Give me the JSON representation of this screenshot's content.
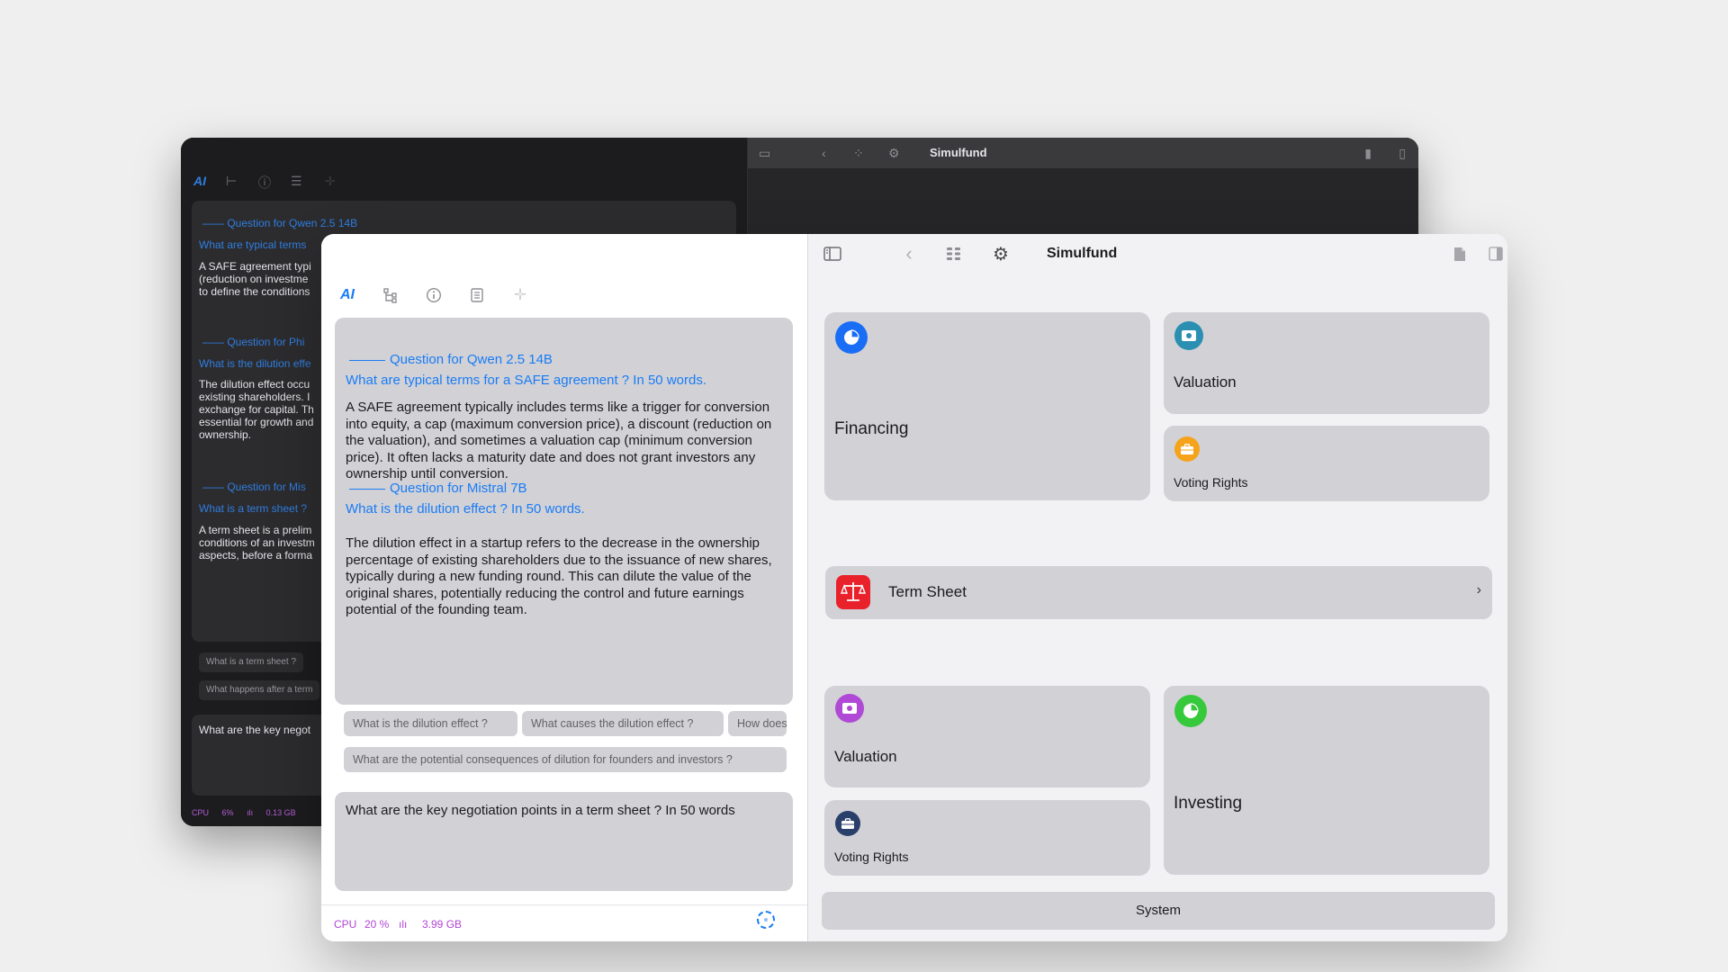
{
  "app_title": "Simulfund",
  "left_tabs": [
    {
      "name": "ai-tab",
      "glyph": "AI"
    },
    {
      "name": "tree-icon",
      "glyph": "⊢"
    },
    {
      "name": "info-icon",
      "glyph": "ⓘ"
    },
    {
      "name": "document-icon",
      "glyph": "☰"
    },
    {
      "name": "add-icon",
      "glyph": "✛"
    }
  ],
  "chat": [
    {
      "header": "Question for Qwen 2.5 14B",
      "question": "What are typical terms for a SAFE agreement ?  In 50 words.",
      "answer": "A SAFE agreement typically includes terms like a trigger for conversion into equity, a cap (maximum conversion price), a discount (reduction on the valuation), and sometimes a valuation cap (minimum conversion price). It often lacks a maturity date and does not grant investors any ownership until conversion."
    },
    {
      "header": "Question for Mistral 7B",
      "question": "What is the dilution effect  ?  In 50 words.",
      "answer": "The dilution effect in a startup refers to the decrease in the ownership percentage of existing shareholders due to the issuance of new shares, typically during a new funding round. This can dilute the value of the original shares, potentially reducing the control and future earnings potential of the founding team."
    }
  ],
  "suggestions": [
    "What is the dilution effect  ?",
    "What causes the dilution effect  ?",
    "How does",
    "What are the potential consequences of dilution for founders and investors  ?"
  ],
  "input_text": "What are the key negotiation points in a term sheet  ?  In 50 words",
  "status": {
    "cpu_label": "CPU",
    "cpu_value": "20 %",
    "mem_glyph": "ılı",
    "mem_value": "3.99 GB"
  },
  "cards": {
    "financing": "Financing",
    "valuation_top": "Valuation",
    "voting_top": "Voting Rights",
    "term_sheet": "Term Sheet",
    "valuation_bottom": "Valuation",
    "voting_bottom": "Voting Rights",
    "investing": "Investing",
    "system": "System"
  },
  "colors": {
    "accent": "#1a7cf5",
    "financing_icon": "#1a6ef5",
    "valuation_top_icon": "#2a8fb0",
    "voting_top_icon": "#f5a31a",
    "term_sheet_icon": "#e8212b",
    "valuation_bottom_icon": "#b04ad6",
    "voting_bottom_icon": "#2b3f6b",
    "investing_icon": "#36c93b",
    "status_text": "#b245d6"
  },
  "back_window": {
    "title": "Simulfund",
    "chat": [
      {
        "header": "Question for Qwen 2.5 14B",
        "question": "What are typical terms",
        "answer": "A SAFE agreement typi\n(reduction on investme\nto define the conditions"
      },
      {
        "header": "Question for Phi",
        "question": "What is the dilution effe",
        "answer": "The dilution effect occu\nexisting shareholders. I\nexchange for capital. Th\nessential for growth and\nownership."
      },
      {
        "header": "Question for Mis",
        "question": "What is a term sheet  ?",
        "answer": "A term sheet is a prelim\nconditions of an investm\naspects, before a forma"
      }
    ],
    "chips": [
      "What is a term sheet  ?",
      "What happens after a term"
    ],
    "input_text": "What are the key negot",
    "status": {
      "cpu_label": "CPU",
      "cpu_value": "6%",
      "mem_glyph": "ılı",
      "mem_value": "0.13 GB"
    }
  }
}
